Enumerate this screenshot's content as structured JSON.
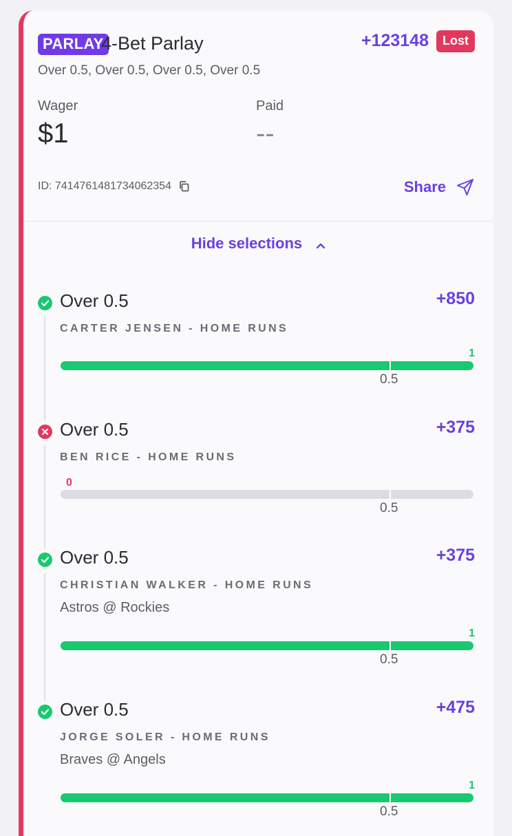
{
  "bet": {
    "type_badge": "PARLAY",
    "title": "4-Bet Parlay",
    "total_odds": "+123148",
    "status": "Lost",
    "subtitle": "Over 0.5, Over 0.5, Over 0.5, Over 0.5",
    "wager_label": "Wager",
    "wager_value": "$1",
    "paid_label": "Paid",
    "paid_value": "--",
    "id_text": "ID: 7414761481734062354",
    "share_label": "Share",
    "toggle_label": "Hide selections"
  },
  "legs": [
    {
      "result": "win",
      "line": "Over 0.5",
      "odds": "+850",
      "market": "CARTER JENSEN - HOME RUNS",
      "matchup": "",
      "actual": "1",
      "threshold": "0.5"
    },
    {
      "result": "loss",
      "line": "Over 0.5",
      "odds": "+375",
      "market": "BEN RICE - HOME RUNS",
      "matchup": "",
      "actual": "0",
      "threshold": "0.5"
    },
    {
      "result": "win",
      "line": "Over 0.5",
      "odds": "+375",
      "market": "CHRISTIAN WALKER - HOME RUNS",
      "matchup": "Astros @ Rockies",
      "actual": "1",
      "threshold": "0.5"
    },
    {
      "result": "win",
      "line": "Over 0.5",
      "odds": "+475",
      "market": "JORGE SOLER - HOME RUNS",
      "matchup": "Braves @ Angels",
      "actual": "1",
      "threshold": "0.5"
    }
  ],
  "colors": {
    "accent": "#6b3fe3",
    "win": "#19c96f",
    "loss": "#e3385e",
    "track": "#dcdce4"
  },
  "icons": {
    "copy": "copy-icon",
    "share": "send-icon",
    "toggle": "chevron-up-icon",
    "win": "check-circle-icon",
    "loss": "x-circle-icon"
  }
}
